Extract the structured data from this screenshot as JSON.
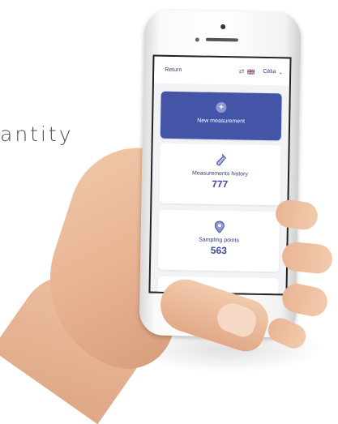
{
  "background_text": "antity",
  "phone_app": {
    "topbar": {
      "return_label": "Return",
      "user_label": "Célia"
    },
    "cards": [
      {
        "label": "New measurement",
        "icon": "plus-icon"
      },
      {
        "label": "Measurements history",
        "count": "777",
        "icon": "test-tube-icon"
      },
      {
        "label": "Sampling points",
        "count": "563",
        "icon": "location-pin-icon"
      }
    ]
  },
  "colors": {
    "accent": "#4455a8",
    "count_text": "#3d4a9e",
    "screen_bg": "#f2f3f7"
  }
}
